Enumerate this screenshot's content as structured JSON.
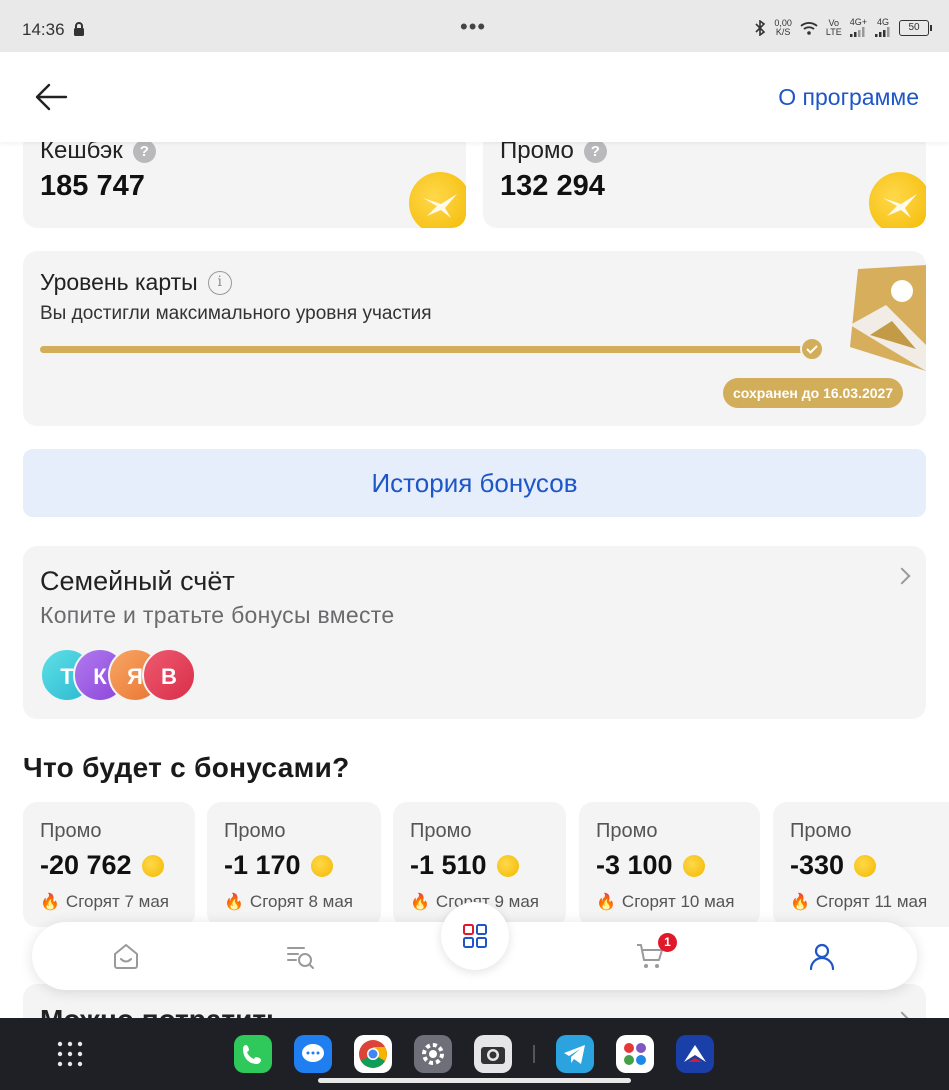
{
  "status_bar": {
    "time": "14:36",
    "network_speed_top": "0,00",
    "network_speed_bottom": "K/S",
    "volte_top": "Vo",
    "volte_bottom": "LTE",
    "sim1": "4G+",
    "sim2": "4G",
    "battery": "50",
    "icons": [
      "lock-icon",
      "more-dots-icon",
      "bluetooth-icon",
      "wifi-icon",
      "signal-icon",
      "battery-icon"
    ]
  },
  "header": {
    "about_label": "О программе"
  },
  "balances": [
    {
      "title": "Кешбэк",
      "value": "185 747"
    },
    {
      "title": "Промо",
      "value": "132 294"
    }
  ],
  "card_level": {
    "title": "Уровень карты",
    "subtitle": "Вы достигли максимального уровня участия",
    "progress": 1.0,
    "saved_until": "сохранен до 16.03.2027"
  },
  "history_button": "История бонусов",
  "family": {
    "title": "Семейный счёт",
    "subtitle": "Копите и тратьте бонусы вместе",
    "members": [
      {
        "letter": "Т",
        "color": "#3ec9d6"
      },
      {
        "letter": "К",
        "color": "#9b57e0"
      },
      {
        "letter": "Я",
        "color": "#f08a3c"
      },
      {
        "letter": "В",
        "color": "#e43a55"
      }
    ]
  },
  "section_title": "Что будет с бонусами?",
  "expiring": [
    {
      "label": "Промо",
      "value": "-20 762",
      "expires": "Сгорят 7 мая"
    },
    {
      "label": "Промо",
      "value": "-1 170",
      "expires": "Сгорят 8 мая"
    },
    {
      "label": "Промо",
      "value": "-1 510",
      "expires": "Сгорят 9 мая"
    },
    {
      "label": "Промо",
      "value": "-3 100",
      "expires": "Сгорят 10 мая"
    },
    {
      "label": "Промо",
      "value": "-330",
      "expires": "Сгорят 11 мая"
    }
  ],
  "next_section_title": "Можно потратить",
  "bottom_nav": {
    "cart_badge": "1",
    "items": [
      "home-icon",
      "catalog-search-icon",
      "grid-icon",
      "cart-icon",
      "profile-icon"
    ]
  },
  "dock": {
    "apps": [
      "phone-app-icon",
      "messages-app-icon",
      "chrome-app-icon",
      "settings-app-icon",
      "camera-app-icon",
      "telegram-app-icon",
      "apps-folder-icon",
      "bank-app-icon"
    ]
  },
  "colors": {
    "accent_blue": "#1e56c7",
    "gold": "#d2ad5a",
    "coin": "#f5c400",
    "card_bg": "#f4f4f5"
  }
}
